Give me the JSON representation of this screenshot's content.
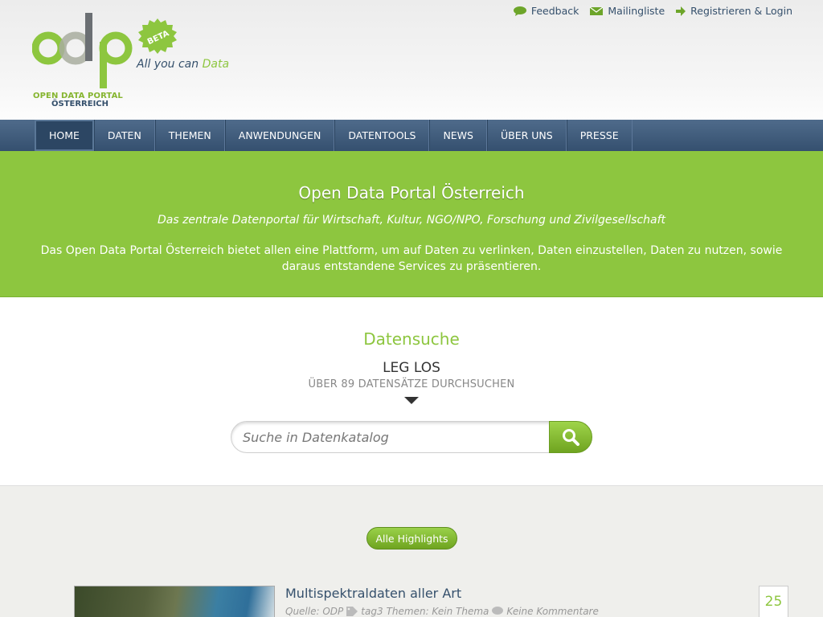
{
  "brand": {
    "line1": "OPEN DATA PORTAL",
    "line2": "ÖSTERREICH",
    "beta": "BETA",
    "tagline_prefix": "All you can",
    "tagline_accent": "Data",
    "colors": {
      "green": "#8dc63f",
      "navy": "#35506c",
      "grey_logo": "#6b6f73"
    }
  },
  "toplinks": [
    {
      "icon": "speech-bubble-icon",
      "label": "Feedback"
    },
    {
      "icon": "envelope-icon",
      "label": "Mailingliste"
    },
    {
      "icon": "arrow-right-icon",
      "label": "Registrieren & Login"
    }
  ],
  "nav": {
    "items": [
      "HOME",
      "DATEN",
      "THEMEN",
      "ANWENDUNGEN",
      "DATENTOOLS",
      "NEWS",
      "ÜBER UNS",
      "PRESSE"
    ],
    "active": "HOME"
  },
  "intro": {
    "title": "Open Data Portal Österreich",
    "subtitle": "Das zentrale Datenportal für Wirtschaft, Kultur, NGO/NPO, Forschung und Zivilgesellschaft",
    "description": "Das Open Data Portal Österreich bietet allen eine Plattform, um auf Daten zu verlinken, Daten einzustellen, Daten zu nutzen, sowie daraus entstandene Services zu präsentieren."
  },
  "search": {
    "heading": "Datensuche",
    "cta": "LEG LOS",
    "count_text": "ÜBER 89 DATENSÄTZE DURCHSUCHEN",
    "placeholder": "Suche in Datenkatalog",
    "button_icon": "magnifier-icon"
  },
  "highlights": {
    "button_label": "Alle Highlights",
    "post": {
      "title": "Multispektraldaten aller Art",
      "source": "Quelle: ODP",
      "tags": "tag3",
      "themes": "Themen: Kein Thema",
      "comments": "Keine Kommentare",
      "day": "25"
    }
  }
}
